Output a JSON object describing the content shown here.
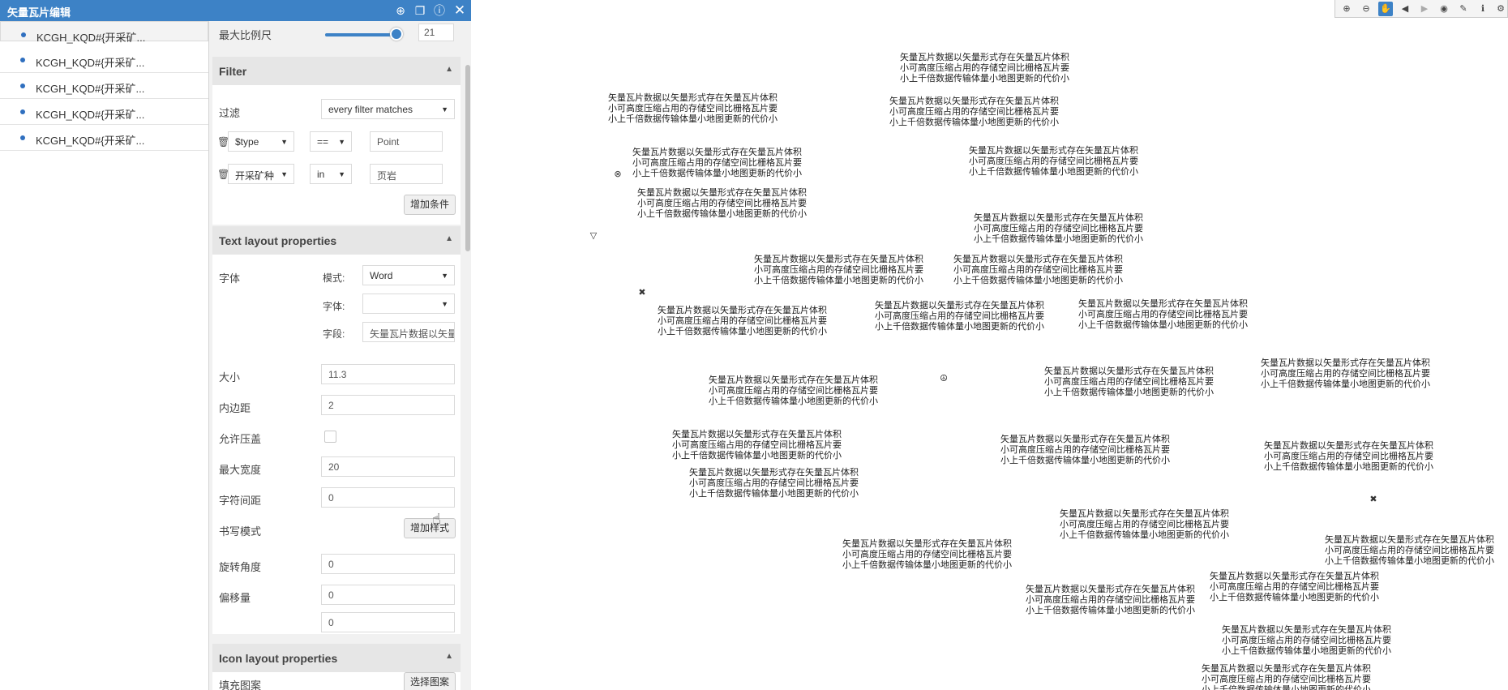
{
  "window": {
    "title": "矢量瓦片编辑",
    "icons": [
      "globe-icon",
      "windows-icon",
      "info-icon",
      "close-icon"
    ]
  },
  "layers": [
    {
      "label": "KCGH_KQD#{开采矿..."
    },
    {
      "label": "KCGH_KQD#{开采矿..."
    },
    {
      "label": "KCGH_KQD#{开采矿..."
    },
    {
      "label": "KCGH_KQD#{开采矿..."
    },
    {
      "label": "KCGH_KQD#{开采矿..."
    }
  ],
  "max_scale": {
    "label": "最大比例尺",
    "value": "21",
    "slider_fraction": 0.92
  },
  "filter": {
    "header": "Filter",
    "label": "过滤",
    "mode": "every filter matches",
    "conditions": [
      {
        "field": "$type",
        "op": "==",
        "value": "Point"
      },
      {
        "field": "开采矿种",
        "op": "in",
        "value": "页岩"
      }
    ],
    "add_button": "增加条件"
  },
  "text_layout": {
    "header": "Text layout properties",
    "font_label": "字体",
    "mode_label": "模式:",
    "mode_value": "Word",
    "font_sub_label": "字体:",
    "font_value": "",
    "field_label": "字段:",
    "field_value": "矢量瓦片数据以矢量形",
    "size_label": "大小",
    "size_value": "11.3",
    "padding_label": "内边距",
    "padding_value": "2",
    "overlap_label": "允许压盖",
    "maxwidth_label": "最大宽度",
    "maxwidth_value": "20",
    "spacing_label": "字符间距",
    "spacing_value": "0",
    "writing_label": "书写模式",
    "add_style_button": "增加样式",
    "rotate_label": "旋转角度",
    "rotate_value": "0",
    "offset_label": "偏移量",
    "offset_x": "0",
    "offset_y": "0"
  },
  "icon_layout": {
    "header": "Icon layout properties",
    "fill_label": "填充图案",
    "choose_button": "选择图案"
  },
  "map": {
    "tools": [
      "zoom-in-icon",
      "zoom-out-icon",
      "pan-hand-icon",
      "back-icon",
      "forward-icon",
      "globe-icon",
      "brush-icon",
      "info-icon",
      "settings-icon"
    ],
    "label_lines": [
      "矢量瓦片数据以矢量形式存在矢量瓦片体积",
      "小可高度压缩占用的存储空间比栅格瓦片要",
      "小上千倍数据传输体量小地图更新的代价小"
    ]
  }
}
